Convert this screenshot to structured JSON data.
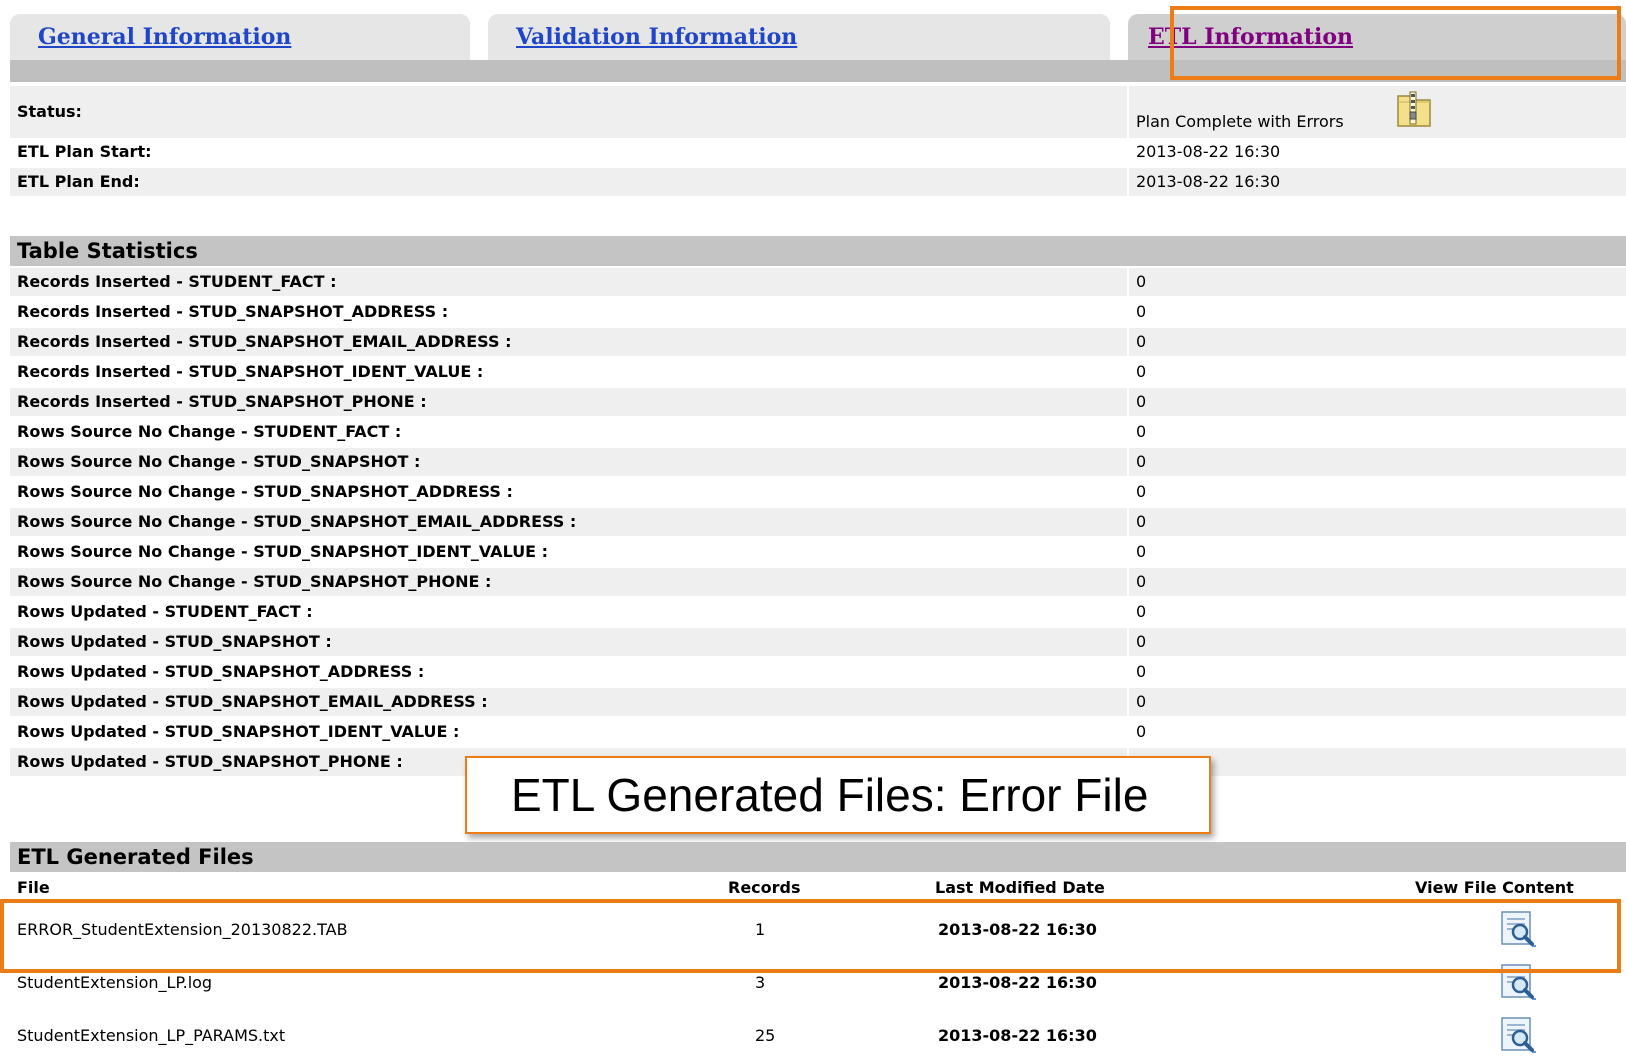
{
  "tabs": [
    {
      "label": "General Information"
    },
    {
      "label": "Validation Information"
    },
    {
      "label": "ETL Information"
    }
  ],
  "status": {
    "label": "Status:",
    "value": "Plan Complete with Errors",
    "icon": "zip-archive-icon"
  },
  "plan": [
    {
      "label": "ETL Plan Start:",
      "value": "2013-08-22 16:30"
    },
    {
      "label": "ETL Plan End:",
      "value": "2013-08-22 16:30"
    }
  ],
  "table_statistics": {
    "title": "Table Statistics",
    "rows": [
      {
        "label": "Records Inserted - STUDENT_FACT :",
        "value": "0"
      },
      {
        "label": "Records Inserted - STUD_SNAPSHOT_ADDRESS :",
        "value": "0"
      },
      {
        "label": "Records Inserted - STUD_SNAPSHOT_EMAIL_ADDRESS :",
        "value": "0"
      },
      {
        "label": "Records Inserted - STUD_SNAPSHOT_IDENT_VALUE :",
        "value": "0"
      },
      {
        "label": "Records Inserted - STUD_SNAPSHOT_PHONE :",
        "value": "0"
      },
      {
        "label": "Rows Source No Change - STUDENT_FACT :",
        "value": "0"
      },
      {
        "label": "Rows Source No Change - STUD_SNAPSHOT :",
        "value": "0"
      },
      {
        "label": "Rows Source No Change - STUD_SNAPSHOT_ADDRESS :",
        "value": "0"
      },
      {
        "label": "Rows Source No Change - STUD_SNAPSHOT_EMAIL_ADDRESS :",
        "value": "0"
      },
      {
        "label": "Rows Source No Change - STUD_SNAPSHOT_IDENT_VALUE :",
        "value": "0"
      },
      {
        "label": "Rows Source No Change - STUD_SNAPSHOT_PHONE :",
        "value": "0"
      },
      {
        "label": "Rows Updated - STUDENT_FACT :",
        "value": "0"
      },
      {
        "label": "Rows Updated - STUD_SNAPSHOT :",
        "value": "0"
      },
      {
        "label": "Rows Updated - STUD_SNAPSHOT_ADDRESS :",
        "value": "0"
      },
      {
        "label": "Rows Updated - STUD_SNAPSHOT_EMAIL_ADDRESS :",
        "value": "0"
      },
      {
        "label": "Rows Updated - STUD_SNAPSHOT_IDENT_VALUE :",
        "value": "0"
      },
      {
        "label": "Rows Updated - STUD_SNAPSHOT_PHONE :",
        "value": ""
      }
    ]
  },
  "callout": {
    "text": "ETL Generated Files: Error File"
  },
  "files": {
    "title": "ETL Generated Files",
    "columns": [
      "File",
      "Records",
      "Last Modified Date",
      "View File Content"
    ],
    "rows": [
      {
        "file": "ERROR_StudentExtension_20130822.TAB",
        "records": "1",
        "date": "2013-08-22 16:30",
        "icon": "view-file-icon"
      },
      {
        "file": "StudentExtension_LP.log",
        "records": "3",
        "date": "2013-08-22 16:30",
        "icon": "view-file-icon"
      },
      {
        "file": "StudentExtension_LP_PARAMS.txt",
        "records": "25",
        "date": "2013-08-22 16:30",
        "icon": "view-file-icon"
      }
    ]
  },
  "colors": {
    "highlight": "#ec7c16",
    "link": "#1f46c8",
    "visited_link": "#800080"
  }
}
